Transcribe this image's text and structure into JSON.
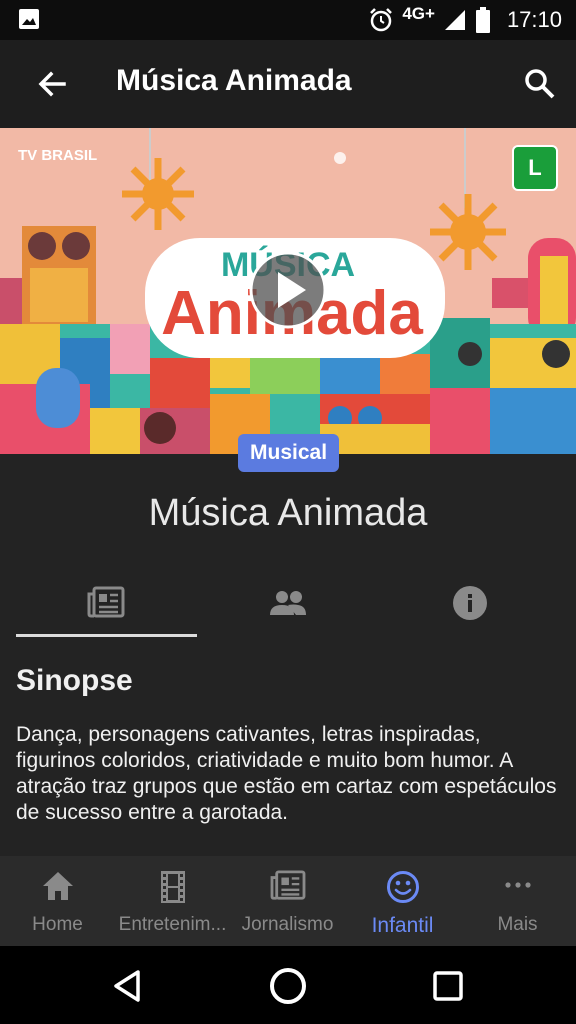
{
  "status_bar": {
    "network": "4G+",
    "time": "17:10"
  },
  "app_bar": {
    "title": "Música Animada"
  },
  "hero": {
    "channel_logo_text": "TV BRASIL",
    "rating": "L",
    "art_line1": "MÚSICA",
    "art_line2": "Animada"
  },
  "genre_badge": "Musical",
  "show_title": "Música Animada",
  "tabs": [
    {
      "icon": "news-icon",
      "selected": true
    },
    {
      "icon": "people-icon",
      "selected": false
    },
    {
      "icon": "info-icon",
      "selected": false
    }
  ],
  "synopsis": {
    "heading": "Sinopse",
    "text": "Dança, personagens cativantes, letras inspiradas, figurinos coloridos, criatividade e muito bom humor. A atração traz grupos que estão em cartaz com espetáculos de sucesso entre a garotada."
  },
  "bottom_nav": [
    {
      "label": "Home",
      "icon": "home-icon"
    },
    {
      "label": "Entretenim...",
      "icon": "film-icon"
    },
    {
      "label": "Jornalismo",
      "icon": "news-icon"
    },
    {
      "label": "Infantil",
      "icon": "smiley-icon",
      "active": true
    },
    {
      "label": "Mais",
      "icon": "more-icon"
    }
  ],
  "colors": {
    "accent": "#5b7be0",
    "active_nav": "#6b8af5",
    "rating_green": "#1a9e3a"
  }
}
